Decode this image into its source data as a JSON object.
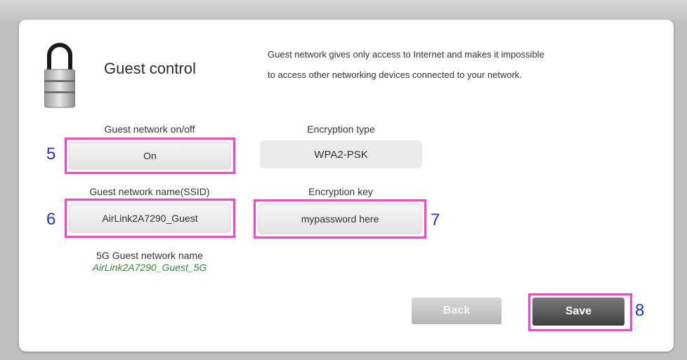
{
  "header": {
    "title": "Guest control",
    "description_line1": "Guest network gives only access to Internet and makes it impossible",
    "description_line2": "to access other networking devices connected to your network."
  },
  "guest_network": {
    "label": "Guest network on/off",
    "value": "On"
  },
  "encryption_type": {
    "label": "Encryption type",
    "value": "WPA2-PSK"
  },
  "ssid": {
    "label": "Guest network name(SSID)",
    "value": "AirLink2A7290_Guest"
  },
  "encryption_key": {
    "label": "Encryption key",
    "value": "mypassword here"
  },
  "guest_5g": {
    "label": "5G Guest network name",
    "value": "AirLink2A7290_Guest_5G"
  },
  "buttons": {
    "back": "Back",
    "save": "Save"
  },
  "annotations": {
    "n5": "5",
    "n6": "6",
    "n7": "7",
    "n8": "8"
  },
  "colors": {
    "highlight": "#ff3fd2",
    "annotation_number": "#1a2fd6",
    "green_text": "#2e8b2e"
  },
  "icons": [
    "lock-icon"
  ]
}
